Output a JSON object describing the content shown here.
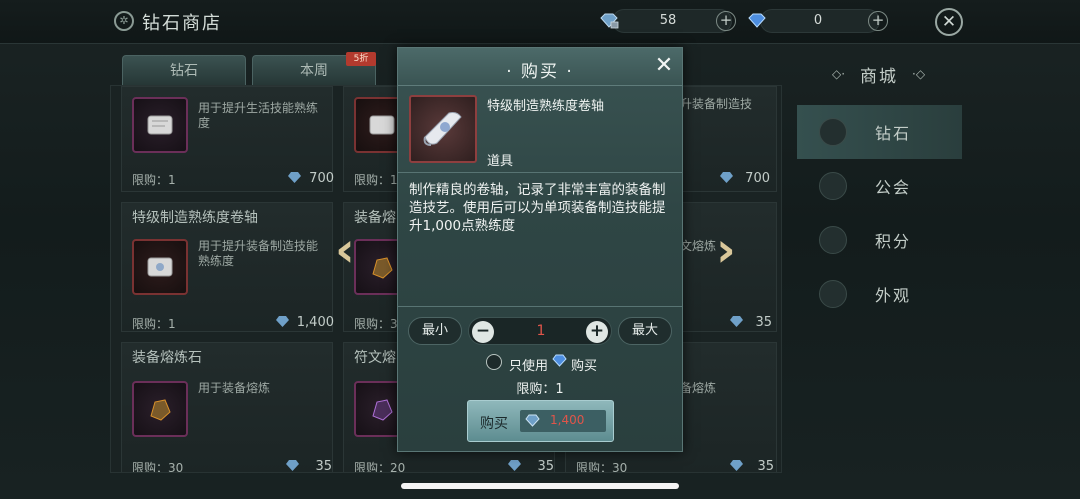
{
  "topbar": {
    "title": "钻石商店",
    "currency1": {
      "value": "58",
      "icon": "bound-diamond-icon"
    },
    "currency2": {
      "value": "0",
      "icon": "diamond-icon"
    }
  },
  "tabs": [
    {
      "label": "钻石"
    },
    {
      "label": "本周"
    }
  ],
  "tab_badge": "5折",
  "cards": {
    "c1": {
      "desc": "用于提升生活技能熟练度",
      "limit": "限购：1",
      "price": "700"
    },
    "c2": {
      "limit": "限购：1"
    },
    "c3": {
      "desc": "升装备制造技",
      "price": "700"
    },
    "c4": {
      "name": "特级制造熟练度卷轴",
      "desc": "用于提升装备制造技能熟练度",
      "limit": "限购：1",
      "price": "1,400"
    },
    "c5": {
      "name": "装备熔",
      "limit": "限购：3"
    },
    "c6": {
      "desc": "文熔炼",
      "price": "35"
    },
    "c7": {
      "name": "装备熔炼石",
      "desc": "用于装备熔炼",
      "limit": "限购：30",
      "price": "35"
    },
    "c8": {
      "name": "符文熔",
      "limit": "限购：20",
      "price": "35"
    },
    "c9": {
      "desc": "备熔炼",
      "limit": "限购：30",
      "price": "35"
    }
  },
  "sidebar": {
    "title": "商城",
    "items": [
      {
        "label": "钻石",
        "active": true
      },
      {
        "label": "公会",
        "active": false
      },
      {
        "label": "积分",
        "active": false
      },
      {
        "label": "外观",
        "active": false
      }
    ]
  },
  "dialog": {
    "title": "· 购买 ·",
    "item_name": "特级制造熟练度卷轴",
    "item_type": "道具",
    "item_desc": "制作精良的卷轴，记录了非常丰富的装备制造技艺。使用后可以为单项装备制造技能提升1,000点熟练度",
    "min_label": "最小",
    "max_label": "最大",
    "quantity": "1",
    "gem_only_prefix": "只使用",
    "gem_only_suffix": "购买",
    "limit": "限购：1",
    "buy_label": "购买",
    "buy_price": "1,400"
  },
  "colors": {
    "accent": "#d9c79a",
    "price_red": "#e0554a",
    "dialog_bg": "#2f4645"
  }
}
